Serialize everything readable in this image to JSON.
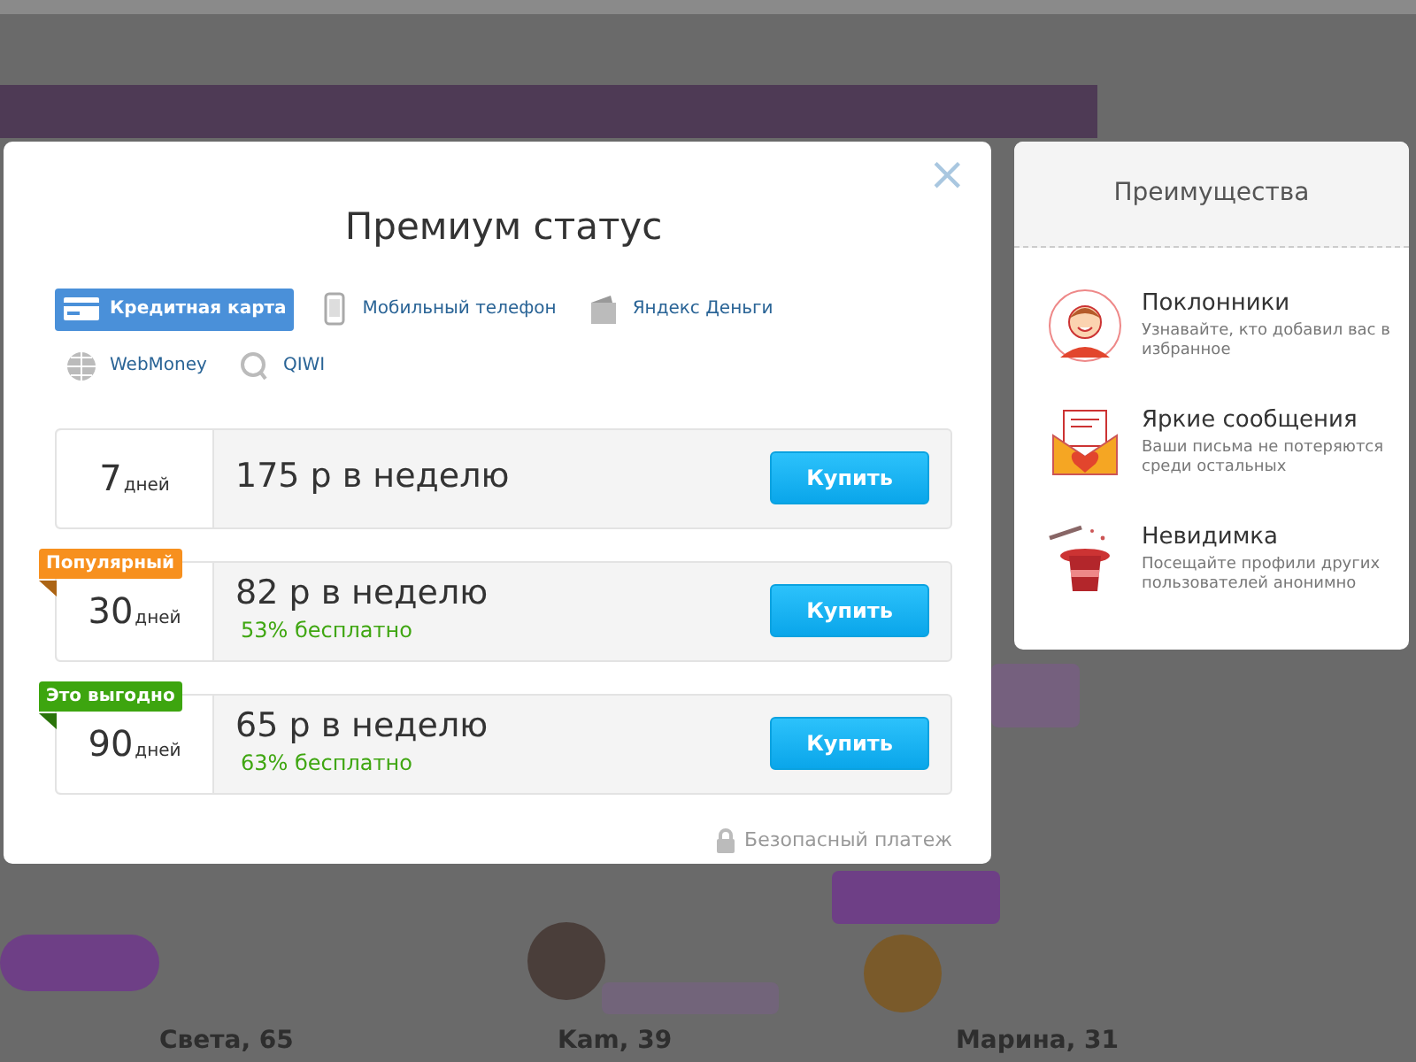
{
  "background": {
    "names": [
      "Света, 65",
      "Kam, 39",
      "Марина, 31"
    ]
  },
  "modal": {
    "close": "×",
    "title": "Премиум статус",
    "payment_methods": [
      {
        "label": "Кредитная карта",
        "kind": "card",
        "selected": true
      },
      {
        "label": "Мобильный телефон",
        "kind": "phone",
        "selected": false
      },
      {
        "label": "Яндекс Деньги",
        "kind": "wallet",
        "selected": false
      },
      {
        "label": "WebMoney",
        "kind": "globe",
        "selected": false
      },
      {
        "label": "QIWI",
        "kind": "qiwi",
        "selected": false
      }
    ],
    "plans": [
      {
        "days": "7",
        "unit": "дней",
        "price": "175 р в неделю",
        "button": "Купить"
      },
      {
        "days": "30",
        "unit": "дней",
        "price": "82 р в неделю",
        "saving": "53% бесплатно",
        "button": "Купить",
        "badge": "Популярный",
        "color": "#f7901e"
      },
      {
        "days": "90",
        "unit": "дней",
        "price": "65 р в неделю",
        "saving": "63% бесплатно",
        "button": "Купить",
        "badge": "Это выгодно",
        "color": "#3da50f"
      }
    ],
    "secure_note": "Безопасный платеж"
  },
  "benefits": {
    "title": "Преимущества",
    "items": [
      {
        "kind": "fans",
        "title": "Поклонники",
        "text": "Узнавайте, кто добавил вас в избранное"
      },
      {
        "kind": "messages",
        "title": "Яркие сообщения",
        "text": "Ваши письма не потеряются среди остальных"
      },
      {
        "kind": "invisible",
        "title": "Невидимка",
        "text": "Посещайте профили других пользователей анонимно"
      }
    ]
  }
}
